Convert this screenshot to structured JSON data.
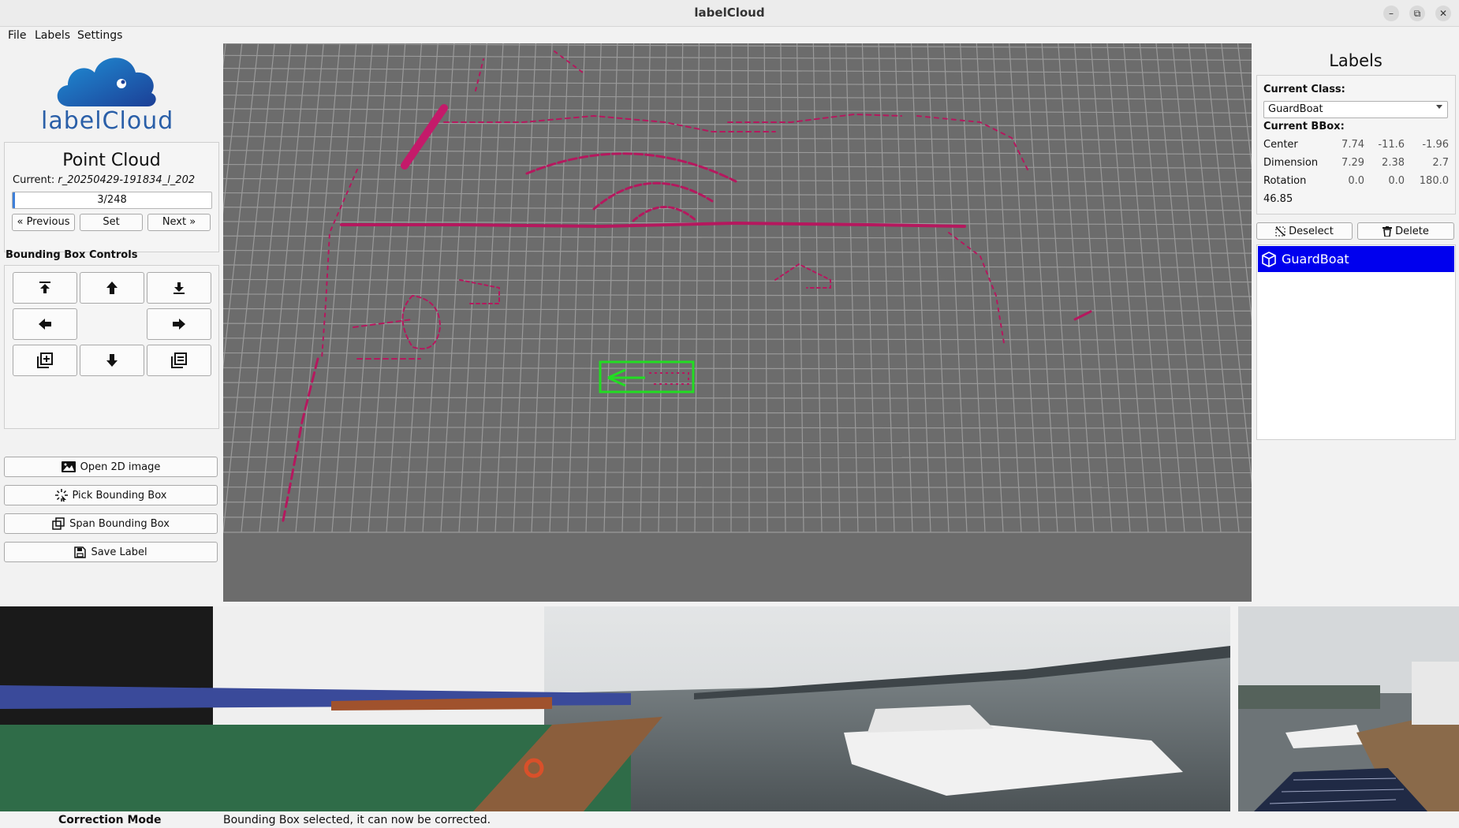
{
  "window": {
    "title": "labelCloud",
    "minimize_icon": "minimize-icon",
    "restore_icon": "restore-icon",
    "close_icon": "close-icon"
  },
  "menu": {
    "items": [
      "File",
      "Labels",
      "Settings"
    ]
  },
  "logo": {
    "text": "labelCloud"
  },
  "point_cloud": {
    "title": "Point Cloud",
    "current_label": "Current:",
    "current_file": "r_20250429-191834_l_202",
    "progress_text": "3/248",
    "progress_fraction": 0.012,
    "prev_label": "« Previous",
    "set_label": "Set",
    "next_label": "Next »"
  },
  "bbox_controls": {
    "title": "Bounding Box Controls",
    "buttons": [
      "move-up-z-icon",
      "arrow-up-icon",
      "move-down-z-icon",
      "arrow-left-icon",
      "rotate-dial",
      "arrow-right-icon",
      "increase-dimension-icon",
      "arrow-down-icon",
      "decrease-dimension-icon"
    ]
  },
  "actions": {
    "open_image": "Open 2D image",
    "pick_bbox": "Pick Bounding Box",
    "span_bbox": "Span Bounding Box",
    "save_label": "Save Label"
  },
  "labels_panel": {
    "title": "Labels",
    "current_class_label": "Current Class:",
    "current_class_value": "GuardBoat",
    "current_bbox_label": "Current BBox:",
    "center": {
      "label": "Center",
      "values": [
        "7.74",
        "-11.6",
        "-1.96"
      ]
    },
    "dimension": {
      "label": "Dimension",
      "values": [
        "7.29",
        "2.38",
        "2.7"
      ]
    },
    "rotation": {
      "label": "Rotation",
      "values": [
        "0.0",
        "0.0",
        "180.0"
      ]
    },
    "volume": "46.85",
    "deselect_label": "Deselect",
    "delete_label": "Delete",
    "list": [
      {
        "label": "GuardBoat",
        "icon": "cube-icon"
      }
    ]
  },
  "status": {
    "mode": "Correction Mode",
    "message": "Bounding Box selected, it can now be corrected."
  },
  "colors": {
    "viewport_bg": "#6c6c6c",
    "grid": "#9a9a9a",
    "points": "#b5185e",
    "bbox": "#22dd22",
    "selection": "#0000ee",
    "progress": "#3d7fd9"
  }
}
